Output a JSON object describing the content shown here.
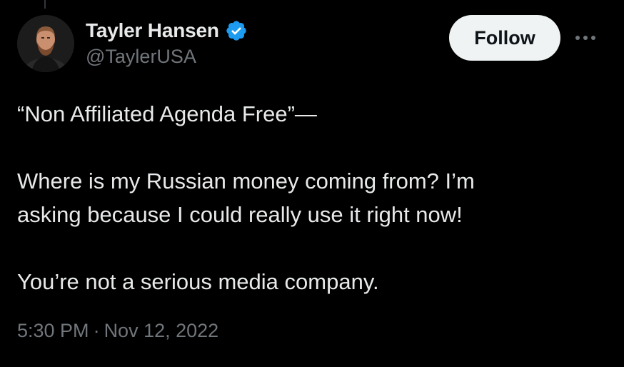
{
  "author": {
    "display_name": "Tayler Hansen",
    "handle": "@TaylerUSA",
    "verified": true,
    "avatar_icon": "profile-photo-icon"
  },
  "actions": {
    "follow_label": "Follow",
    "more_icon": "more-options-icon"
  },
  "tweet": {
    "line1": "“Non Affiliated Agenda Free”—",
    "line2": "Where is my Russian money coming from? I’m",
    "line3": "asking because I could really use it right now!",
    "line4": "You’re not a serious media company."
  },
  "meta": {
    "time": "5:30 PM",
    "separator": "·",
    "date": "Nov 12, 2022"
  },
  "colors": {
    "background": "#000000",
    "text_primary": "#e7e9ea",
    "text_secondary": "#71767b",
    "verified_badge": "#1d9bf0",
    "follow_button_bg": "#eff3f4",
    "follow_button_text": "#0f1419"
  }
}
